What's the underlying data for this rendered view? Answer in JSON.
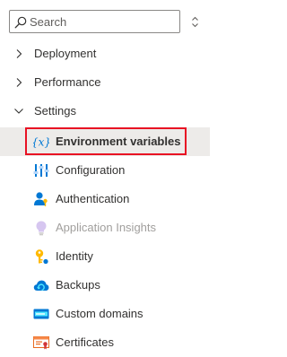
{
  "search": {
    "placeholder": "Search",
    "value": ""
  },
  "menu": {
    "groups": [
      {
        "label": "Deployment",
        "expanded": false
      },
      {
        "label": "Performance",
        "expanded": false
      },
      {
        "label": "Settings",
        "expanded": true
      }
    ],
    "settings_items": [
      {
        "label": "Environment variables",
        "icon": "variable-icon",
        "selected": true,
        "highlighted": true
      },
      {
        "label": "Configuration",
        "icon": "configuration-icon"
      },
      {
        "label": "Authentication",
        "icon": "authentication-icon"
      },
      {
        "label": "Application Insights",
        "icon": "lightbulb-icon",
        "disabled": true
      },
      {
        "label": "Identity",
        "icon": "identity-key-icon"
      },
      {
        "label": "Backups",
        "icon": "cloud-backup-icon"
      },
      {
        "label": "Custom domains",
        "icon": "custom-domain-icon"
      },
      {
        "label": "Certificates",
        "icon": "certificate-icon"
      }
    ]
  },
  "colors": {
    "highlight_border": "#e81123",
    "selected_background": "#edebe9",
    "text": "#323130",
    "disabled_text": "#a19f9d"
  }
}
